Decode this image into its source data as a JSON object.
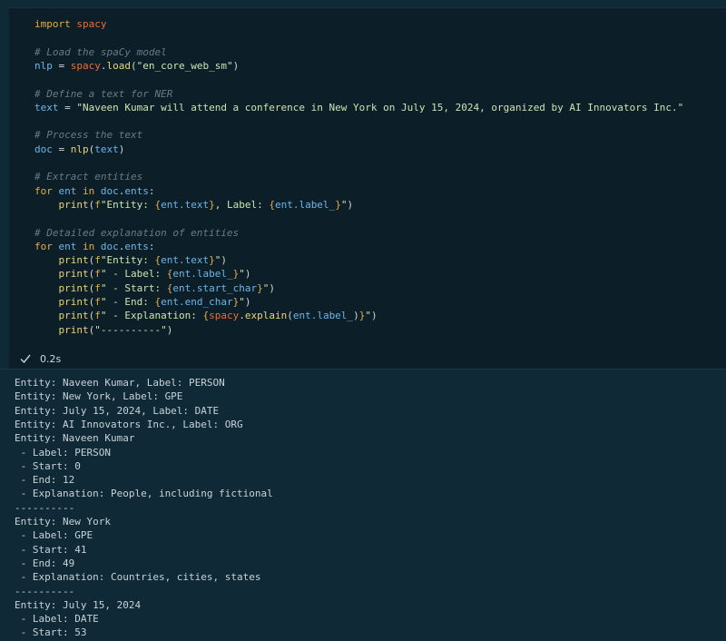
{
  "code_cell": {
    "lines": [
      {
        "parts": [
          [
            "kw",
            "import "
          ],
          [
            "mod",
            "spacy"
          ]
        ]
      },
      {
        "parts": []
      },
      {
        "parts": [
          [
            "cmt",
            "# Load the spaCy model"
          ]
        ]
      },
      {
        "parts": [
          [
            "var",
            "nlp"
          ],
          [
            "op",
            " = "
          ],
          [
            "mod",
            "spacy"
          ],
          [
            "op",
            "."
          ],
          [
            "fn",
            "load"
          ],
          [
            "op",
            "("
          ],
          [
            "str",
            "\"en_core_web_sm\""
          ],
          [
            "op",
            ")"
          ]
        ]
      },
      {
        "parts": []
      },
      {
        "parts": [
          [
            "cmt",
            "# Define a text for NER"
          ]
        ]
      },
      {
        "parts": [
          [
            "var",
            "text"
          ],
          [
            "op",
            " = "
          ],
          [
            "str",
            "\"Naveen Kumar will attend a conference in New York on July 15, 2024, organized by AI Innovators Inc.\""
          ]
        ]
      },
      {
        "parts": []
      },
      {
        "parts": [
          [
            "cmt",
            "# Process the text"
          ]
        ]
      },
      {
        "parts": [
          [
            "var",
            "doc"
          ],
          [
            "op",
            " = "
          ],
          [
            "fn",
            "nlp"
          ],
          [
            "op",
            "("
          ],
          [
            "var",
            "text"
          ],
          [
            "op",
            ")"
          ]
        ]
      },
      {
        "parts": []
      },
      {
        "parts": [
          [
            "cmt",
            "# Extract entities"
          ]
        ]
      },
      {
        "parts": [
          [
            "kw",
            "for "
          ],
          [
            "var",
            "ent"
          ],
          [
            "kw",
            " in "
          ],
          [
            "var",
            "doc"
          ],
          [
            "op",
            "."
          ],
          [
            "var",
            "ents"
          ],
          [
            "op",
            ":"
          ]
        ]
      },
      {
        "parts": [
          [
            "op",
            "    "
          ],
          [
            "fn",
            "print"
          ],
          [
            "op",
            "("
          ],
          [
            "fstr",
            "f"
          ],
          [
            "str",
            "\"Entity: "
          ],
          [
            "fstr",
            "{"
          ],
          [
            "var",
            "ent.text"
          ],
          [
            "fstr",
            "}"
          ],
          [
            "str",
            ", Label: "
          ],
          [
            "fstr",
            "{"
          ],
          [
            "var",
            "ent.label_"
          ],
          [
            "fstr",
            "}"
          ],
          [
            "str",
            "\""
          ],
          [
            "op",
            ")"
          ]
        ]
      },
      {
        "parts": []
      },
      {
        "parts": [
          [
            "cmt",
            "# Detailed explanation of entities"
          ]
        ]
      },
      {
        "parts": [
          [
            "kw",
            "for "
          ],
          [
            "var",
            "ent"
          ],
          [
            "kw",
            " in "
          ],
          [
            "var",
            "doc"
          ],
          [
            "op",
            "."
          ],
          [
            "var",
            "ents"
          ],
          [
            "op",
            ":"
          ]
        ]
      },
      {
        "parts": [
          [
            "op",
            "    "
          ],
          [
            "fn",
            "print"
          ],
          [
            "op",
            "("
          ],
          [
            "fstr",
            "f"
          ],
          [
            "str",
            "\"Entity: "
          ],
          [
            "fstr",
            "{"
          ],
          [
            "var",
            "ent.text"
          ],
          [
            "fstr",
            "}"
          ],
          [
            "str",
            "\""
          ],
          [
            "op",
            ")"
          ]
        ]
      },
      {
        "parts": [
          [
            "op",
            "    "
          ],
          [
            "fn",
            "print"
          ],
          [
            "op",
            "("
          ],
          [
            "fstr",
            "f"
          ],
          [
            "str",
            "\" - Label: "
          ],
          [
            "fstr",
            "{"
          ],
          [
            "var",
            "ent.label_"
          ],
          [
            "fstr",
            "}"
          ],
          [
            "str",
            "\""
          ],
          [
            "op",
            ")"
          ]
        ]
      },
      {
        "parts": [
          [
            "op",
            "    "
          ],
          [
            "fn",
            "print"
          ],
          [
            "op",
            "("
          ],
          [
            "fstr",
            "f"
          ],
          [
            "str",
            "\" - Start: "
          ],
          [
            "fstr",
            "{"
          ],
          [
            "var",
            "ent.start_char"
          ],
          [
            "fstr",
            "}"
          ],
          [
            "str",
            "\""
          ],
          [
            "op",
            ")"
          ]
        ]
      },
      {
        "parts": [
          [
            "op",
            "    "
          ],
          [
            "fn",
            "print"
          ],
          [
            "op",
            "("
          ],
          [
            "fstr",
            "f"
          ],
          [
            "str",
            "\" - End: "
          ],
          [
            "fstr",
            "{"
          ],
          [
            "var",
            "ent.end_char"
          ],
          [
            "fstr",
            "}"
          ],
          [
            "str",
            "\""
          ],
          [
            "op",
            ")"
          ]
        ]
      },
      {
        "parts": [
          [
            "op",
            "    "
          ],
          [
            "fn",
            "print"
          ],
          [
            "op",
            "("
          ],
          [
            "fstr",
            "f"
          ],
          [
            "str",
            "\" - Explanation: "
          ],
          [
            "fstr",
            "{"
          ],
          [
            "mod",
            "spacy"
          ],
          [
            "op",
            "."
          ],
          [
            "fn",
            "explain"
          ],
          [
            "op",
            "("
          ],
          [
            "var",
            "ent.label_"
          ],
          [
            "op",
            ")"
          ],
          [
            "fstr",
            "}"
          ],
          [
            "str",
            "\""
          ],
          [
            "op",
            ")"
          ]
        ]
      },
      {
        "parts": [
          [
            "op",
            "    "
          ],
          [
            "fn",
            "print"
          ],
          [
            "op",
            "("
          ],
          [
            "str",
            "\"----------\""
          ],
          [
            "op",
            ")"
          ]
        ]
      }
    ]
  },
  "status": {
    "check_icon": "check-icon",
    "exec_time": "0.2s",
    "check_color": "#3fb950"
  },
  "output": {
    "lines": [
      "Entity: Naveen Kumar, Label: PERSON",
      "Entity: New York, Label: GPE",
      "Entity: July 15, 2024, Label: DATE",
      "Entity: AI Innovators Inc., Label: ORG",
      "Entity: Naveen Kumar",
      " - Label: PERSON",
      " - Start: 0",
      " - End: 12",
      " - Explanation: People, including fictional",
      "----------",
      "Entity: New York",
      " - Label: GPE",
      " - Start: 41",
      " - End: 49",
      " - Explanation: Countries, cities, states",
      "----------",
      "Entity: July 15, 2024",
      " - Label: DATE",
      " - Start: 53"
    ]
  }
}
